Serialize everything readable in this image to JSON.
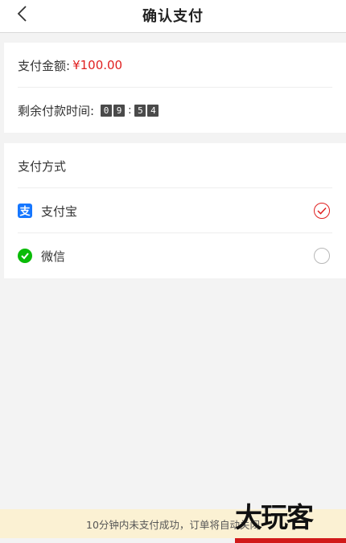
{
  "header": {
    "title": "确认支付",
    "back_icon": "chevron-left-icon"
  },
  "payment_info": {
    "amount_label": "支付金额:",
    "amount_value": "¥100.00",
    "time_label": "剩余付款时间:",
    "countdown": [
      "0",
      "9",
      "5",
      "4"
    ]
  },
  "payment_methods": {
    "title": "支付方式",
    "options": [
      {
        "label": "支付宝",
        "icon": "alipay-icon",
        "selected": true
      },
      {
        "label": "微信",
        "icon": "wechat-icon",
        "selected": false
      }
    ]
  },
  "notice": {
    "text": "10分钟内未支付成功，订单将自动关闭"
  },
  "watermark": {
    "text": "大玩客"
  },
  "colors": {
    "accent_red": "#e02020",
    "alipay_blue": "#1677ff",
    "wechat_green": "#09bb07",
    "notice_bg": "#fbf1d3"
  }
}
